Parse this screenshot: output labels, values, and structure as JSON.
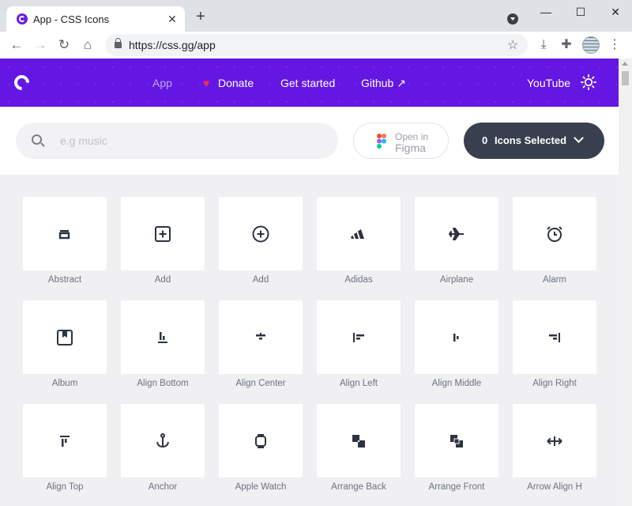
{
  "browser": {
    "tab_title": "App - CSS Icons",
    "tab_close": "✕",
    "new_tab": "+",
    "window_controls": {
      "minimize": "—",
      "maximize": "☐",
      "close": "✕"
    },
    "url": "https://css.gg/app",
    "icons": [
      "back-icon",
      "forward-icon",
      "reload-icon",
      "home-icon",
      "lock-icon",
      "star-icon",
      "download-icon",
      "extensions-icon",
      "profile-icon",
      "menu-icon"
    ]
  },
  "nav": {
    "links": [
      "App",
      "Donate",
      "Get started",
      "Github",
      "YouTube"
    ],
    "accent_color": "#6417e3"
  },
  "search": {
    "placeholder": "e.g music",
    "figma_line1": "Open in",
    "figma_line2": "Figma",
    "selected_count": "0",
    "selected_label": "Icons Selected"
  },
  "icons": [
    "Abstract",
    "Add",
    "Add",
    "Adidas",
    "Airplane",
    "Alarm",
    "Album",
    "Align Bottom",
    "Align Center",
    "Align Left",
    "Align Middle",
    "Align Right",
    "Align Top",
    "Anchor",
    "Apple Watch",
    "Arrange Back",
    "Arrange Front",
    "Arrow Align H"
  ]
}
